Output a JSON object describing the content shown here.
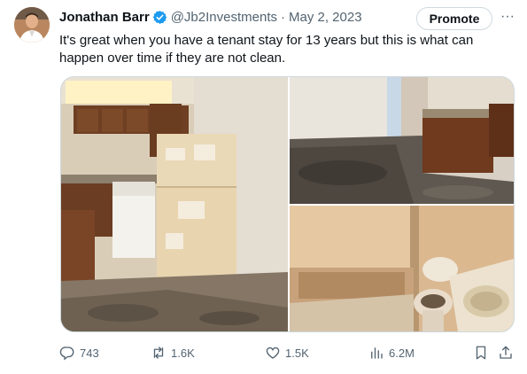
{
  "author": {
    "name": "Jonathan Barr",
    "handle": "@Jb2Investments",
    "separator": "·",
    "date": "May 2, 2023"
  },
  "promote_label": "Promote",
  "more_label": "···",
  "tweet_text": "It's great when you have a tenant stay for 13 years but this is what can happen over time if they are not clean.",
  "stats": {
    "replies": "743",
    "reposts": "1.6K",
    "likes": "1.5K",
    "views": "6.2M"
  },
  "colors": {
    "verified": "#1d9bf0",
    "secondary_text": "#536471",
    "border": "#cfd9de"
  },
  "icons": {
    "verified": "verified-badge-icon",
    "reply": "reply-icon",
    "repost": "repost-icon",
    "like": "heart-icon",
    "views": "views-icon",
    "bookmark": "bookmark-icon",
    "share": "share-icon"
  }
}
